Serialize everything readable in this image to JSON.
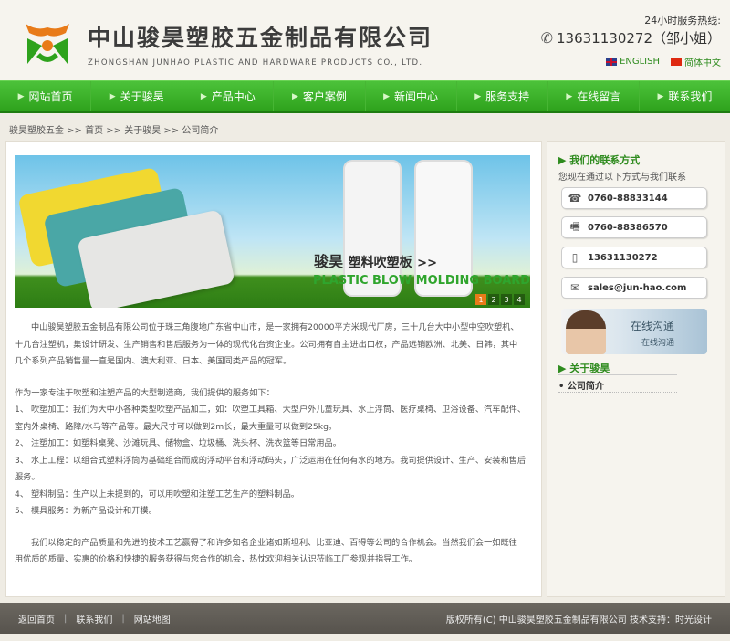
{
  "header": {
    "company_cn": "中山骏昊塑胶五金制品有限公司",
    "company_en": "ZHONGSHAN JUNHAO PLASTIC AND HARDWARE PRODUCTS CO., LTD.",
    "hotline_label": "24小时服务热线:",
    "hotline_number": "13631130272（邹小姐）",
    "lang_en": "ENGLISH",
    "lang_cn": "简体中文",
    "brand_colors": {
      "green": "#2ea21c",
      "orange": "#e87b19"
    }
  },
  "nav": {
    "items": [
      {
        "label": "网站首页"
      },
      {
        "label": "关于骏昊"
      },
      {
        "label": "产品中心"
      },
      {
        "label": "客户案例"
      },
      {
        "label": "新闻中心"
      },
      {
        "label": "服务支持"
      },
      {
        "label": "在线留言"
      },
      {
        "label": "联系我们"
      }
    ],
    "arrow": "▶"
  },
  "breadcrumb": "骏昊塑胶五金 >> 首页 >> 关于骏昊 >> 公司简介",
  "banner": {
    "title_cn_brand": "骏昊",
    "title_cn_product": "塑料吹塑板",
    "title_arrows": ">>",
    "title_en": "PLASTIC BLOW MOLDING BOARD",
    "pages": [
      "1",
      "2",
      "3",
      "4"
    ]
  },
  "article": {
    "p1": "中山骏昊塑胶五金制品有限公司位于珠三角腹地广东省中山市，是一家拥有20000平方米现代厂房，三十几台大中小型中空吹塑机、十几台注塑机，集设计研发、生产销售和售后服务为一体的现代化台资企业。公司拥有自主进出口权，产品远销欧洲、北美、日韩，其中几个系列产品销售量一直是国内、澳大利亚、日本、美国同类产品的冠军。",
    "p2": "作为一家专注于吹塑和注塑产品的大型制造商，我们提供的服务如下：",
    "p3": "1、 吹塑加工：我们为大中小各种类型吹塑产品加工，如：吹塑工具箱、大型户外儿童玩具、水上浮筒、医疗桌椅、卫浴设备、汽车配件、室内外桌椅、路障/水马等产品等。最大尺寸可以做到2m长，最大重量可以做到25kg。",
    "p4": "2、 注塑加工：如塑料桌凳、沙滩玩具、储物盒、垃圾桶、洗头杯、洗衣篮等日常用品。",
    "p5": "3、 水上工程：以组合式塑料浮筒为基础组合而成的浮动平台和浮动码头，广泛运用在任何有水的地方。我司提供设计、生产、安装和售后服务。",
    "p6": "4、 塑料制品：生产以上未提到的，可以用吹塑和注塑工艺生产的塑料制品。",
    "p7": "5、 模具服务：为新产品设计和开模。",
    "p8": "我们以稳定的产品质量和先进的技术工艺赢得了和许多知名企业诸如斯坦利、比亚迪、百得等公司的合作机会。当然我们会一如既往用优质的质量、实惠的价格和快捷的服务获得与您合作的机会，热忱欢迎相关认识莅临工厂参观并指导工作。"
  },
  "sidebar": {
    "contact_title": "我们的联系方式",
    "contact_sub": "您现在通过以下方式与我们联系",
    "contacts": [
      {
        "icon": "telephone-icon",
        "text": "0760-88833144"
      },
      {
        "icon": "fax-icon",
        "text": "0760-88386570"
      },
      {
        "icon": "mobile-icon",
        "text": "13631130272"
      },
      {
        "icon": "email-icon",
        "text": "sales@jun-hao.com"
      }
    ],
    "chat_text": "在线沟通",
    "chat_sub": "在线沟通",
    "about_title": "关于骏昊",
    "intro_link": "公司简介"
  },
  "footer": {
    "links": [
      "返回首页",
      "联系我们",
      "网站地图"
    ],
    "copyright": "版权所有(C) 中山骏昊塑胶五金制品有限公司 技术支持：时光设计"
  }
}
